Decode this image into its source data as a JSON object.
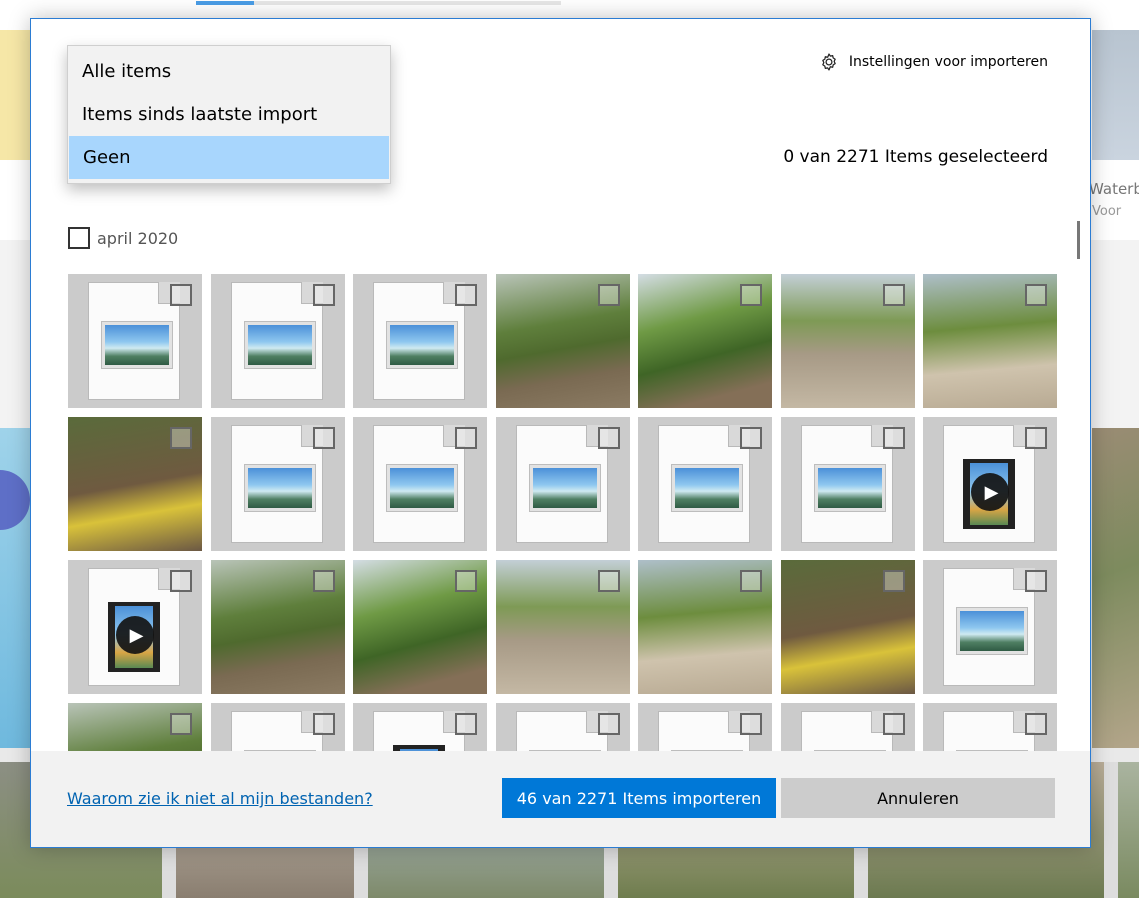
{
  "background": {
    "side_text_1": "Waterb",
    "side_text_2": "Voor"
  },
  "dialog": {
    "settings_label": "Instellingen voor importeren",
    "settings_icon": "gear-icon",
    "selected_count": "0 van 2271 Items geselecteerd",
    "group_label": "april 2020",
    "accent_color": "#0078d7"
  },
  "dropdown": {
    "items": [
      {
        "label": "Alle items",
        "selected": false
      },
      {
        "label": "Items sinds laatste import",
        "selected": false
      },
      {
        "label": "Geen",
        "selected": true
      }
    ]
  },
  "grid": {
    "tiles": [
      {
        "kind": "placeholder-image",
        "checked": false
      },
      {
        "kind": "placeholder-image",
        "checked": false
      },
      {
        "kind": "placeholder-image",
        "checked": false
      },
      {
        "kind": "photo",
        "checked": false
      },
      {
        "kind": "photo",
        "checked": false
      },
      {
        "kind": "photo",
        "checked": false
      },
      {
        "kind": "photo",
        "checked": false
      },
      {
        "kind": "photo",
        "checked": false
      },
      {
        "kind": "placeholder-image",
        "checked": false
      },
      {
        "kind": "placeholder-image",
        "checked": false
      },
      {
        "kind": "placeholder-image",
        "checked": false
      },
      {
        "kind": "placeholder-image",
        "checked": false
      },
      {
        "kind": "placeholder-image",
        "checked": false
      },
      {
        "kind": "placeholder-video",
        "checked": false
      },
      {
        "kind": "placeholder-video",
        "checked": false
      },
      {
        "kind": "photo",
        "checked": false
      },
      {
        "kind": "photo",
        "checked": false
      },
      {
        "kind": "photo",
        "checked": false
      },
      {
        "kind": "photo",
        "checked": false
      },
      {
        "kind": "photo",
        "checked": false
      },
      {
        "kind": "placeholder-image",
        "checked": false
      },
      {
        "kind": "photo",
        "checked": false
      },
      {
        "kind": "placeholder-image",
        "checked": false
      },
      {
        "kind": "placeholder-video",
        "checked": false
      },
      {
        "kind": "placeholder-image",
        "checked": false
      },
      {
        "kind": "placeholder-image",
        "checked": false
      },
      {
        "kind": "placeholder-image",
        "checked": false
      },
      {
        "kind": "placeholder-image",
        "checked": false
      }
    ]
  },
  "footer": {
    "help_link": "Waarom zie ik niet al mijn bestanden?",
    "import_button": "46 van 2271 Items importeren",
    "cancel_button": "Annuleren"
  }
}
